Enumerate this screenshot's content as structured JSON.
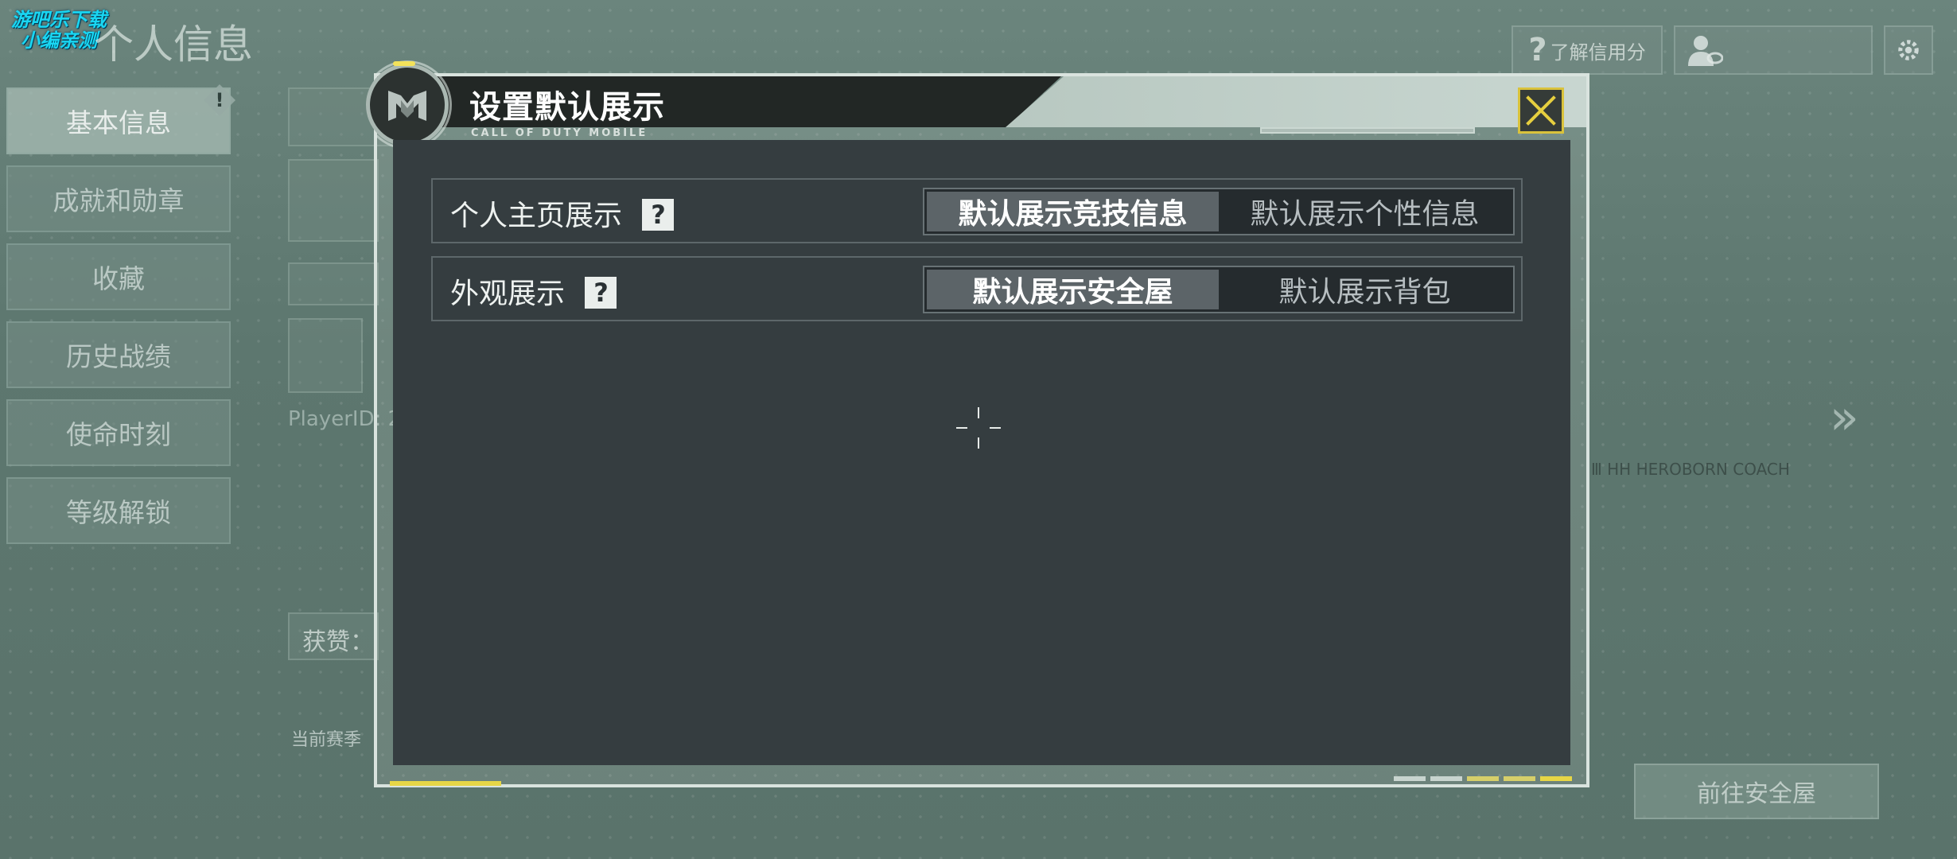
{
  "watermark": {
    "line1": "游吧乐下载",
    "line2": "小编亲测"
  },
  "page": {
    "title": "个人信息"
  },
  "sidebar": {
    "items": [
      {
        "label": "基本信息",
        "active": true,
        "badge": "!"
      },
      {
        "label": "成就和勋章"
      },
      {
        "label": "收藏"
      },
      {
        "label": "历史战绩"
      },
      {
        "label": "使命时刻"
      },
      {
        "label": "等级解锁"
      }
    ]
  },
  "top_right": {
    "credit_label": "了解信用分",
    "credit_icon": "question-mark-icon",
    "profile_icon": "profile-view-icon",
    "settings_icon": "gear-icon"
  },
  "background": {
    "player_id_label": "PlayerID: 2",
    "likes_label": "获赞：",
    "season_label": "当前赛季",
    "goto_button": "前往安全屋",
    "caption": "Ⅲ HH HEROBORN COACH"
  },
  "modal": {
    "title": "设置默认展示",
    "subtitle": "CALL OF DUTY MOBILE",
    "logo_icon": "cod-m-logo-icon",
    "close_icon": "close-x-icon",
    "rows": [
      {
        "label": "个人主页展示",
        "help": "?",
        "options": [
          "默认展示竞技信息",
          "默认展示个性信息"
        ],
        "selected_index": 0
      },
      {
        "label": "外观展示",
        "help": "?",
        "options": [
          "默认展示安全屋",
          "默认展示背包"
        ],
        "selected_index": 0
      }
    ]
  },
  "colors": {
    "accent_yellow": "#e7d646",
    "modal_body": "#353d40",
    "header_dark": "#222725",
    "selected_segment": "#5c6468",
    "watermark_cyan": "#19d6f2"
  }
}
